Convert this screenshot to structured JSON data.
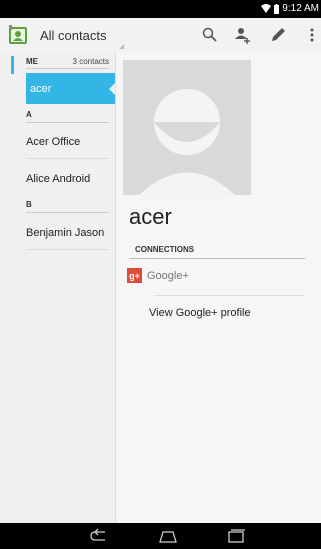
{
  "status_bar": {
    "time": "9:12 AM"
  },
  "action_bar": {
    "title": "All contacts",
    "actions": [
      "search-icon",
      "add-contact-icon",
      "edit-icon",
      "overflow-menu-icon"
    ]
  },
  "contacts_list": {
    "me_header": {
      "label": "ME",
      "count": "3 contacts"
    },
    "me_item": "acer",
    "section_a": "A",
    "a_items": [
      "Acer Office",
      "Alice Android"
    ],
    "section_b": "B",
    "b_items": [
      "Benjamin Jason"
    ]
  },
  "detail": {
    "name": "acer",
    "connections_header": "CONNECTIONS",
    "service_name": "Google+",
    "service_badge": "g+",
    "view_profile": "View Google+ profile"
  },
  "colors": {
    "accent": "#33b5e5",
    "google_plus": "#dd4b39"
  },
  "nav_bar": [
    "back-icon",
    "home-icon",
    "recent-apps-icon"
  ]
}
